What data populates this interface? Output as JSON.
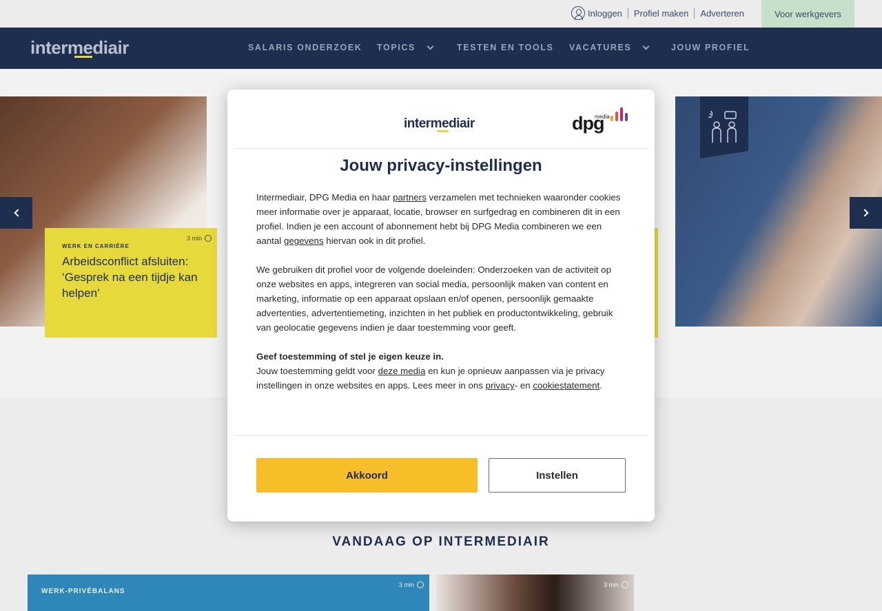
{
  "utility_bar": {
    "login": "Inloggen",
    "create_profile": "Profiel maken",
    "advertise": "Adverteren",
    "employers": "Voor werkgevers"
  },
  "main_nav": {
    "logo": "intermediair",
    "items": [
      {
        "label": "SALARIS ONDERZOEK",
        "has_dropdown": false
      },
      {
        "label": "TOPICS",
        "has_dropdown": true
      },
      {
        "label": "TESTEN EN TOOLS",
        "has_dropdown": false
      },
      {
        "label": "VACATURES",
        "has_dropdown": true
      },
      {
        "label": "JOUW PROFIEL",
        "has_dropdown": false
      }
    ]
  },
  "carousel": {
    "left_card": {
      "category": "Werk en carrière",
      "title": "Arbeidsconflict afsluiten: ‘Gesprek na een tijdje kan helpen’",
      "read_time": "3 min"
    }
  },
  "consent_modal": {
    "logo": "intermediair",
    "partner_logo": "dpg",
    "partner_logo_sub": "media",
    "title": "Jouw privacy-instellingen",
    "p1": {
      "t1": "Intermediair, DPG Media en haar ",
      "link1": "partners",
      "t2": " verzamelen met technieken waaronder cookies meer informatie over je apparaat, locatie, browser en surfgedrag en combineren dit in een profiel. Indien je een account of abonnement hebt bij DPG Media combineren we een aantal ",
      "link2": "gegevens",
      "t3": " hiervan ook in dit profiel."
    },
    "p2": "We gebruiken dit profiel voor de volgende doeleinden: Onderzoeken van de activiteit op onze websites en apps, integreren van social media, persoonlijk maken van content en marketing, informatie op een apparaat opslaan en/of openen, persoonlijk gemaakte advertenties, advertentiemeting, inzichten in het publiek en productontwikkeling, gebruik van geolocatie gegevens indien je daar toestemming voor geeft.",
    "p3": {
      "heading": "Geef toestemming of stel je eigen keuze in.",
      "t1": "Jouw toestemming geldt voor ",
      "link1": "deze media",
      "t2": " en kun je opnieuw aanpassen via je privacy instellingen in onze websites en apps. Lees meer in ons ",
      "link2": "privacy",
      "t3": "- en ",
      "link3": "cookiestatement",
      "t4": "."
    },
    "accept_label": "Akkoord",
    "settings_label": "Instellen"
  },
  "today_section": {
    "title": "VANDAAG OP INTERMEDIAIR",
    "cards": [
      {
        "category": "WERK-PRIVÉBALANS",
        "read_time": "3 min"
      },
      {
        "category": "",
        "read_time": "3 min"
      }
    ]
  },
  "colors": {
    "navy": "#1e2e4f",
    "yellow_card": "#e6d93b",
    "accept_button": "#f8be2a",
    "employers_bg": "#c8dfc9",
    "blue_card": "#2f86b8"
  }
}
